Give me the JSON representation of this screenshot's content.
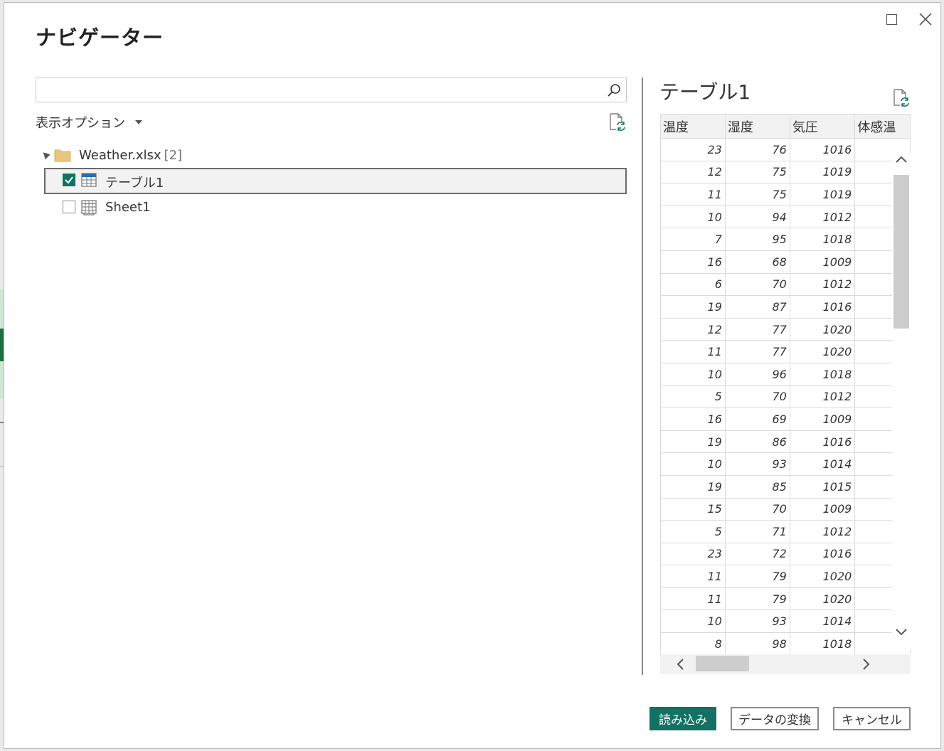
{
  "dialog": {
    "title": "ナビゲーター",
    "window_controls": {
      "maximize_icon": "maximize-icon",
      "close_icon": "close-icon"
    }
  },
  "left_pane": {
    "search": {
      "value": "",
      "placeholder": "",
      "icon": "search-icon"
    },
    "display_options": "表示オプション",
    "refresh_icon": "refresh-file-icon",
    "tree": {
      "root": {
        "label": "Weather.xlsx",
        "count": "[2]",
        "expanded": true,
        "icon": "folder-icon"
      },
      "items": [
        {
          "label": "テーブル1",
          "checked": true,
          "selected": true,
          "icon": "table-icon"
        },
        {
          "label": "Sheet1",
          "checked": false,
          "selected": false,
          "icon": "sheet-icon"
        }
      ]
    }
  },
  "preview": {
    "title": "テーブル1",
    "refresh_icon": "refresh-file-icon",
    "columns": [
      "温度",
      "湿度",
      "気圧",
      "体感温"
    ],
    "rows": [
      [
        "23",
        "76",
        "1016"
      ],
      [
        "12",
        "75",
        "1019"
      ],
      [
        "11",
        "75",
        "1019"
      ],
      [
        "10",
        "94",
        "1012"
      ],
      [
        "7",
        "95",
        "1018"
      ],
      [
        "16",
        "68",
        "1009"
      ],
      [
        "6",
        "70",
        "1012"
      ],
      [
        "19",
        "87",
        "1016"
      ],
      [
        "12",
        "77",
        "1020"
      ],
      [
        "11",
        "77",
        "1020"
      ],
      [
        "10",
        "96",
        "1018"
      ],
      [
        "5",
        "70",
        "1012"
      ],
      [
        "16",
        "69",
        "1009"
      ],
      [
        "19",
        "86",
        "1016"
      ],
      [
        "10",
        "93",
        "1014"
      ],
      [
        "19",
        "85",
        "1015"
      ],
      [
        "15",
        "70",
        "1009"
      ],
      [
        "5",
        "71",
        "1012"
      ],
      [
        "23",
        "72",
        "1016"
      ],
      [
        "11",
        "79",
        "1020"
      ],
      [
        "11",
        "79",
        "1020"
      ],
      [
        "10",
        "93",
        "1014"
      ],
      [
        "8",
        "98",
        "1018"
      ],
      [
        "",
        "",
        ""
      ]
    ]
  },
  "buttons": {
    "load": "読み込み",
    "transform": "データの変換",
    "cancel": "キャンセル"
  },
  "colors": {
    "accent": "#127162",
    "folder": "#e8c77c",
    "table_icon": "#2b6cb0"
  }
}
